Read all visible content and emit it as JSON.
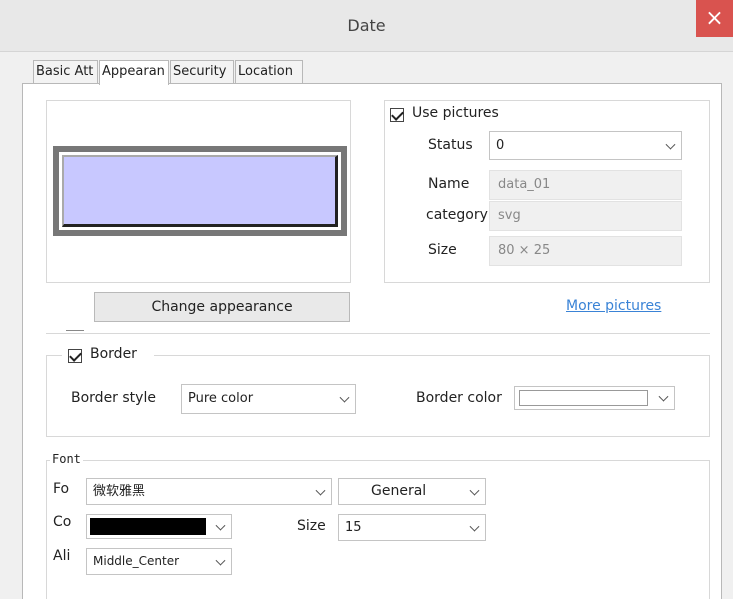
{
  "window": {
    "title": "Date",
    "close_glyph": "×"
  },
  "tabs": [
    {
      "label": "Basic Att"
    },
    {
      "label": "Appearan"
    },
    {
      "label": "Security"
    },
    {
      "label": "Location"
    }
  ],
  "appearance": {
    "change_button": "Change appearance",
    "use_pictures": {
      "label": "Use pictures",
      "checked": true
    },
    "status": {
      "label": "Status",
      "value": "0"
    },
    "name": {
      "label": "Name",
      "value": "data_01"
    },
    "category": {
      "label": "category",
      "value": "svg"
    },
    "size": {
      "label": "Size",
      "value": "80 × 25"
    },
    "more_pictures": "More pictures"
  },
  "border": {
    "label": "Border",
    "checked": true,
    "style_label": "Border style",
    "style_value": "Pure color",
    "color_label": "Border color",
    "color_value": "#ffffff"
  },
  "font": {
    "group_label": "Font",
    "font_label": "Fo",
    "font_value": "微软雅黑",
    "weight_value": "General",
    "color_label": "Co",
    "color_value": "#000000",
    "size_label": "Size",
    "size_value": "15",
    "align_label": "Ali",
    "align_value": "Middle_Center"
  },
  "colors": {
    "preview_fill": "#c8c8ff",
    "preview_frame": "#777777",
    "link": "#3a83d6",
    "close_bg": "#d9534f"
  }
}
